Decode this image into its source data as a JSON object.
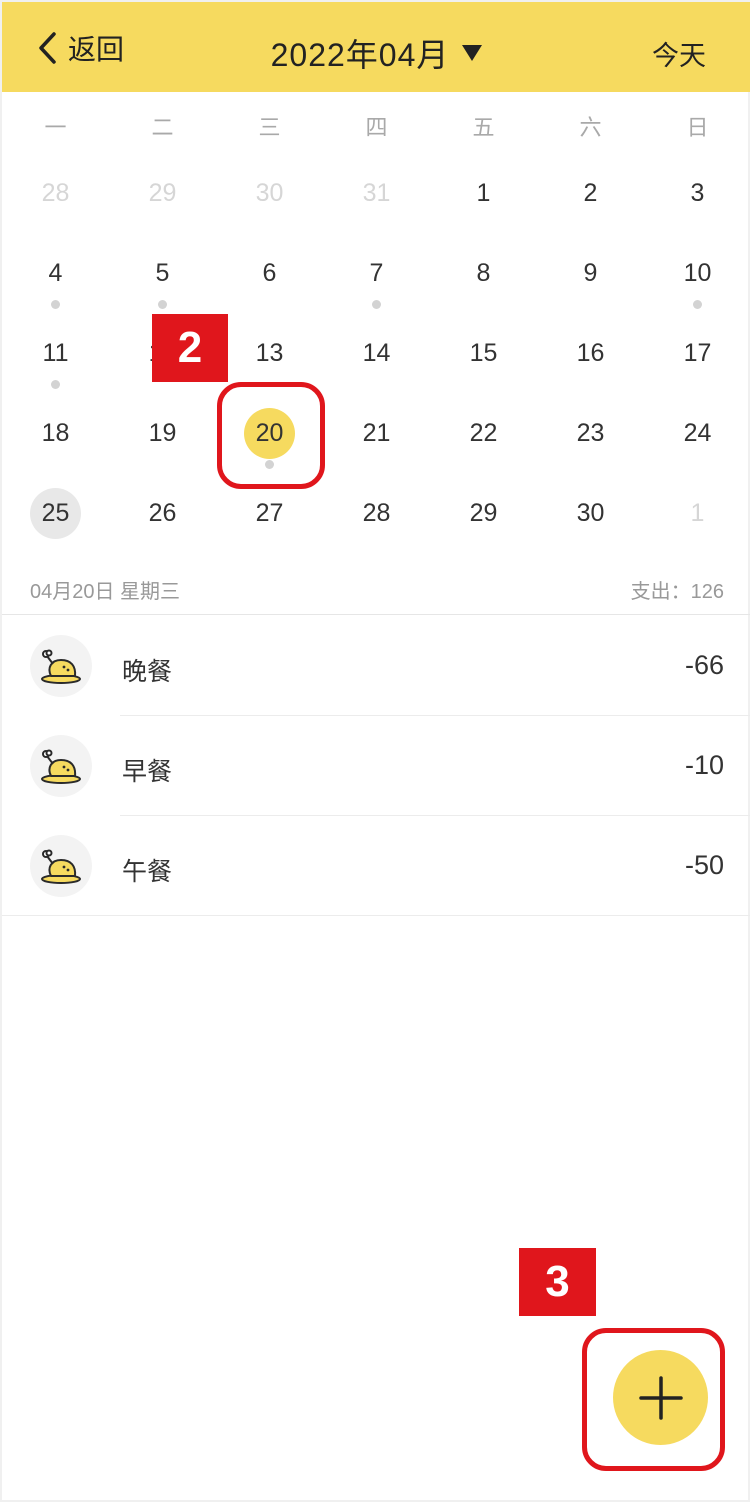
{
  "header": {
    "back_label": "返回",
    "title": "2022年04月",
    "today_label": "今天",
    "bg_color": "#f6da5f"
  },
  "weekdays": [
    "一",
    "二",
    "三",
    "四",
    "五",
    "六",
    "日"
  ],
  "calendar": {
    "days": [
      {
        "n": "28",
        "muted": true
      },
      {
        "n": "29",
        "muted": true
      },
      {
        "n": "30",
        "muted": true
      },
      {
        "n": "31",
        "muted": true
      },
      {
        "n": "1"
      },
      {
        "n": "2"
      },
      {
        "n": "3"
      },
      {
        "n": "4",
        "dot": true
      },
      {
        "n": "5",
        "dot": true
      },
      {
        "n": "6"
      },
      {
        "n": "7",
        "dot": true
      },
      {
        "n": "8"
      },
      {
        "n": "9"
      },
      {
        "n": "10",
        "dot": true
      },
      {
        "n": "11",
        "dot": true
      },
      {
        "n": "12"
      },
      {
        "n": "13"
      },
      {
        "n": "14"
      },
      {
        "n": "15"
      },
      {
        "n": "16"
      },
      {
        "n": "17"
      },
      {
        "n": "18"
      },
      {
        "n": "19"
      },
      {
        "n": "20",
        "dot": true,
        "selected": true
      },
      {
        "n": "21"
      },
      {
        "n": "22"
      },
      {
        "n": "23"
      },
      {
        "n": "24"
      },
      {
        "n": "25",
        "today": true
      },
      {
        "n": "26"
      },
      {
        "n": "27"
      },
      {
        "n": "28"
      },
      {
        "n": "29"
      },
      {
        "n": "30"
      },
      {
        "n": "1",
        "muted": true
      }
    ]
  },
  "summary": {
    "date": "04月20日  星期三",
    "spend": "支出：126"
  },
  "entries": [
    {
      "label": "晚餐",
      "amount": "-66",
      "icon": "chicken-icon"
    },
    {
      "label": "早餐",
      "amount": "-10",
      "icon": "chicken-icon"
    },
    {
      "label": "午餐",
      "amount": "-50",
      "icon": "chicken-icon"
    }
  ],
  "annotations": {
    "step2": "2",
    "step3": "3",
    "color": "#e0161c"
  },
  "fab": {
    "icon": "plus-icon"
  }
}
